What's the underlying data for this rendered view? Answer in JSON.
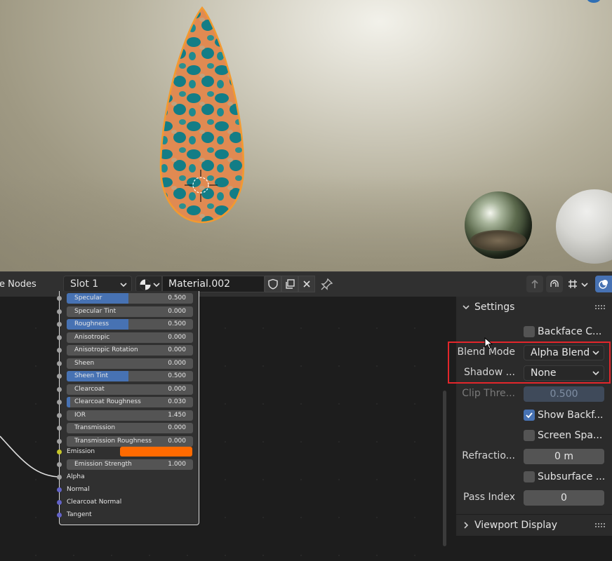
{
  "viewport": {
    "background_color": "#b7b29e",
    "outline_color": "#f39a2f"
  },
  "header": {
    "editor_title": "e Nodes",
    "slot": "Slot 1",
    "material_name": "Material.002"
  },
  "node": {
    "fields": [
      {
        "label": "Specular",
        "value": "0.500",
        "fill": 0.5
      },
      {
        "label": "Specular Tint",
        "value": "0.000",
        "fill": 0
      },
      {
        "label": "Roughness",
        "value": "0.500",
        "fill": 0.5
      },
      {
        "label": "Anisotropic",
        "value": "0.000",
        "fill": 0
      },
      {
        "label": "Anisotropic Rotation",
        "value": "0.000",
        "fill": 0
      },
      {
        "label": "Sheen",
        "value": "0.000",
        "fill": 0
      },
      {
        "label": "Sheen Tint",
        "value": "0.500",
        "fill": 0.5
      },
      {
        "label": "Clearcoat",
        "value": "0.000",
        "fill": 0
      },
      {
        "label": "Clearcoat Roughness",
        "value": "0.030",
        "fill": 0.03
      },
      {
        "label": "IOR",
        "value": "1.450",
        "fill": 0
      },
      {
        "label": "Transmission",
        "value": "0.000",
        "fill": 0
      },
      {
        "label": "Transmission Roughness",
        "value": "0.000",
        "fill": 0
      }
    ],
    "emission_label": "Emission",
    "emission_color": "#ff6a00",
    "emission_strength": {
      "label": "Emission Strength",
      "value": "1.000",
      "fill": 0
    },
    "inputs": [
      "Alpha",
      "Normal",
      "Clearcoat Normal",
      "Tangent"
    ]
  },
  "settings": {
    "title": "Settings",
    "backface_culling": {
      "label": "Backface C...",
      "checked": false
    },
    "blend_mode": {
      "label": "Blend Mode",
      "value": "Alpha Blend"
    },
    "shadow_mode": {
      "label": "Shadow ...",
      "value": "None"
    },
    "clip_threshold": {
      "label": "Clip Thre...",
      "value": "0.500"
    },
    "show_backface": {
      "label": "Show Backf...",
      "checked": true
    },
    "screen_space": {
      "label": "Screen Spa...",
      "checked": false
    },
    "refraction": {
      "label": "Refractio...",
      "value": "0 m"
    },
    "subsurface": {
      "label": "Subsurface ...",
      "checked": false
    },
    "pass_index": {
      "label": "Pass Index",
      "value": "0"
    }
  },
  "viewport_display": {
    "title": "Viewport Display"
  },
  "colors": {
    "accent": "#4772b3",
    "highlight": "#e3262b",
    "panel": "#2b2b2b"
  }
}
